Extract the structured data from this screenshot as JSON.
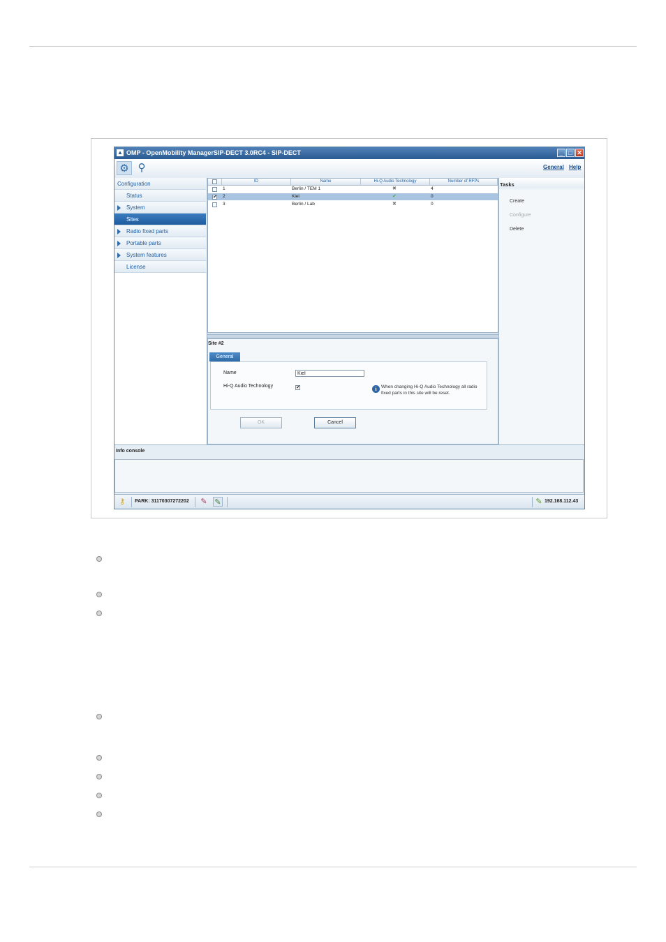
{
  "window": {
    "title": "OMP - OpenMobility ManagerSIP-DECT 3.0RC4 - SIP-DECT",
    "links": {
      "general": "General",
      "help": "Help"
    },
    "controls": {
      "minimize": "_",
      "maximize": "□",
      "close": "✕"
    }
  },
  "toolbar": {
    "config_icon": "gear-icon",
    "search_icon": "search-icon"
  },
  "nav": {
    "items": [
      {
        "label": "Configuration",
        "type": "header"
      },
      {
        "label": "Status",
        "type": "leaf"
      },
      {
        "label": "System",
        "type": "group"
      },
      {
        "label": "Sites",
        "type": "leaf",
        "active": true
      },
      {
        "label": "Radio fixed parts",
        "type": "group"
      },
      {
        "label": "Portable parts",
        "type": "group"
      },
      {
        "label": "System features",
        "type": "group"
      },
      {
        "label": "License",
        "type": "leaf"
      }
    ]
  },
  "table": {
    "columns": [
      "ID",
      "Name",
      "Hi-Q Audio Technology",
      "Number of RFPs"
    ],
    "rows": [
      {
        "id": "1",
        "name": "Berlin / TEM 1",
        "hiq": "✖",
        "rfps": "4",
        "checked": false,
        "selected": false
      },
      {
        "id": "2",
        "name": "Kiel",
        "hiq": "✔",
        "rfps": "0",
        "checked": true,
        "selected": true
      },
      {
        "id": "3",
        "name": "Berlin / Lab",
        "hiq": "✖",
        "rfps": "0",
        "checked": false,
        "selected": false
      }
    ]
  },
  "detail": {
    "header": "Site #2",
    "tab": "General",
    "name_label": "Name",
    "name_value": "Kiel",
    "hiq_label": "Hi-Q Audio Technology",
    "hiq_checked": "✔",
    "info_text": "When changing Hi-Q Audio Technology all radio fixed parts in this site will be reset.",
    "ok": "OK",
    "cancel": "Cancel"
  },
  "tasks": {
    "header": "Tasks",
    "items": [
      {
        "label": "Create",
        "enabled": true
      },
      {
        "label": "Configure",
        "enabled": false
      },
      {
        "label": "Delete",
        "enabled": true
      }
    ]
  },
  "console": {
    "header": "Info console"
  },
  "status": {
    "park": "PARK: 31170307272202",
    "ip": "192.168.112.43"
  },
  "colors": {
    "accent": "#2f6aa6",
    "selection": "#a9c4e0"
  }
}
